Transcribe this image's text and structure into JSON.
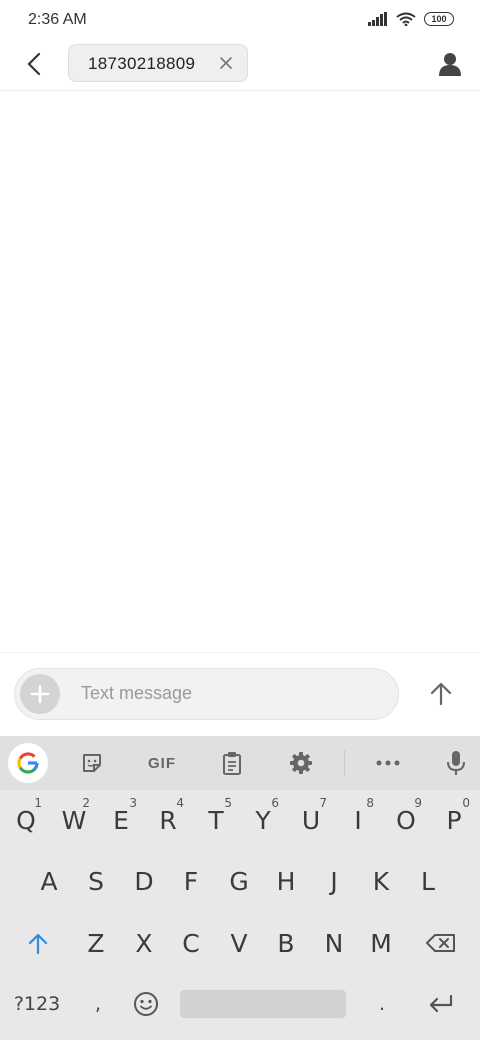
{
  "status_bar": {
    "time": "2:36 AM",
    "battery": "100"
  },
  "header": {
    "recipient": "18730218809"
  },
  "compose": {
    "placeholder": "Text message"
  },
  "keyboard": {
    "toolbar": {
      "gif_label": "GIF"
    },
    "row1": [
      {
        "key": "Q",
        "hint": "1"
      },
      {
        "key": "W",
        "hint": "2"
      },
      {
        "key": "E",
        "hint": "3"
      },
      {
        "key": "R",
        "hint": "4"
      },
      {
        "key": "T",
        "hint": "5"
      },
      {
        "key": "Y",
        "hint": "6"
      },
      {
        "key": "U",
        "hint": "7"
      },
      {
        "key": "I",
        "hint": "8"
      },
      {
        "key": "O",
        "hint": "9"
      },
      {
        "key": "P",
        "hint": "0"
      }
    ],
    "row2": [
      "A",
      "S",
      "D",
      "F",
      "G",
      "H",
      "J",
      "K",
      "L"
    ],
    "row3": [
      "Z",
      "X",
      "C",
      "V",
      "B",
      "N",
      "M"
    ],
    "row4": {
      "symbols": "?123",
      "comma": ",",
      "period": "."
    }
  },
  "colors": {
    "accent_shift": "#2a8de0",
    "keyboard_bg": "#e8e8e8",
    "toolbar_bg": "#e0e0e0"
  },
  "icons": [
    "back-arrow-icon",
    "close-icon",
    "contact-icon",
    "plus-icon",
    "send-arrow-icon",
    "google-g-icon",
    "sticker-icon",
    "clipboard-icon",
    "gear-icon",
    "more-icon",
    "microphone-icon",
    "shift-icon",
    "backspace-icon",
    "emoji-icon",
    "enter-icon"
  ]
}
